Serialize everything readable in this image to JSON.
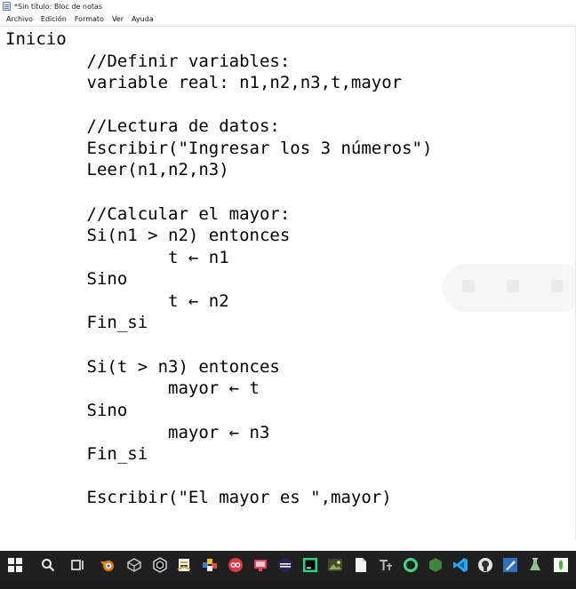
{
  "window": {
    "title": "*Sin título: Bloc de notas",
    "menu": [
      "Archivo",
      "Edición",
      "Formato",
      "Ver",
      "Ayuda"
    ]
  },
  "editor": {
    "lines": [
      "Inicio",
      "        //Definir variables:",
      "        variable real: n1,n2,n3,t,mayor",
      "",
      "        //Lectura de datos:",
      "        Escribir(\"Ingresar los 3 números\")",
      "        Leer(n1,n2,n3)",
      "",
      "        //Calcular el mayor:",
      "        Si(n1 > n2) entonces",
      "                t ← n1",
      "        Sino",
      "                t ← n2",
      "        Fin_si",
      "",
      "        Si(t > n3) entonces",
      "                mayor ← t",
      "        Sino",
      "                mayor ← n3",
      "        Fin_si",
      "",
      "        Escribir(\"El mayor es \",mayor)"
    ]
  },
  "taskbar": {
    "icons": [
      {
        "name": "start-icon",
        "color": "#f0f0f0"
      },
      {
        "name": "search-icon",
        "color": "#f0f0f0"
      },
      {
        "name": "task-view-icon",
        "color": "#f0f0f0"
      },
      {
        "name": "blender-icon",
        "color": "#e87d0d"
      },
      {
        "name": "cube-3d-icon",
        "color": "#bdbdbd"
      },
      {
        "name": "unity-icon",
        "color": "#d0d0d0"
      },
      {
        "name": "pseint-icon",
        "color": "#c9b037"
      },
      {
        "name": "tiles-app-icon",
        "color": "#e74c3c"
      },
      {
        "name": "red-circle-app-icon",
        "color": "#e5343f"
      },
      {
        "name": "monitor-app-icon",
        "color": "#e0465b"
      },
      {
        "name": "eclipse-icon",
        "color": "#2c2255"
      },
      {
        "name": "pycharm-icon",
        "color": "#21d789"
      },
      {
        "name": "image-editor-icon",
        "color": "#6b7c3c"
      },
      {
        "name": "file-icon",
        "color": "#f2f2f2"
      },
      {
        "name": "typora-icon",
        "color": "#bbbbbb"
      },
      {
        "name": "android-studio-ring-icon",
        "color": "#3ddc84"
      },
      {
        "name": "node-hex-icon",
        "color": "#3c873a"
      },
      {
        "name": "vscode-icon",
        "color": "#23a9f2"
      },
      {
        "name": "github-desktop-icon",
        "color": "#e6e6e6"
      },
      {
        "name": "drawing-app-icon",
        "color": "#2f6fbf"
      },
      {
        "name": "flask-app-icon",
        "color": "#8fbf8f"
      },
      {
        "name": "mongodb-icon",
        "color": "#4faa41"
      }
    ]
  }
}
